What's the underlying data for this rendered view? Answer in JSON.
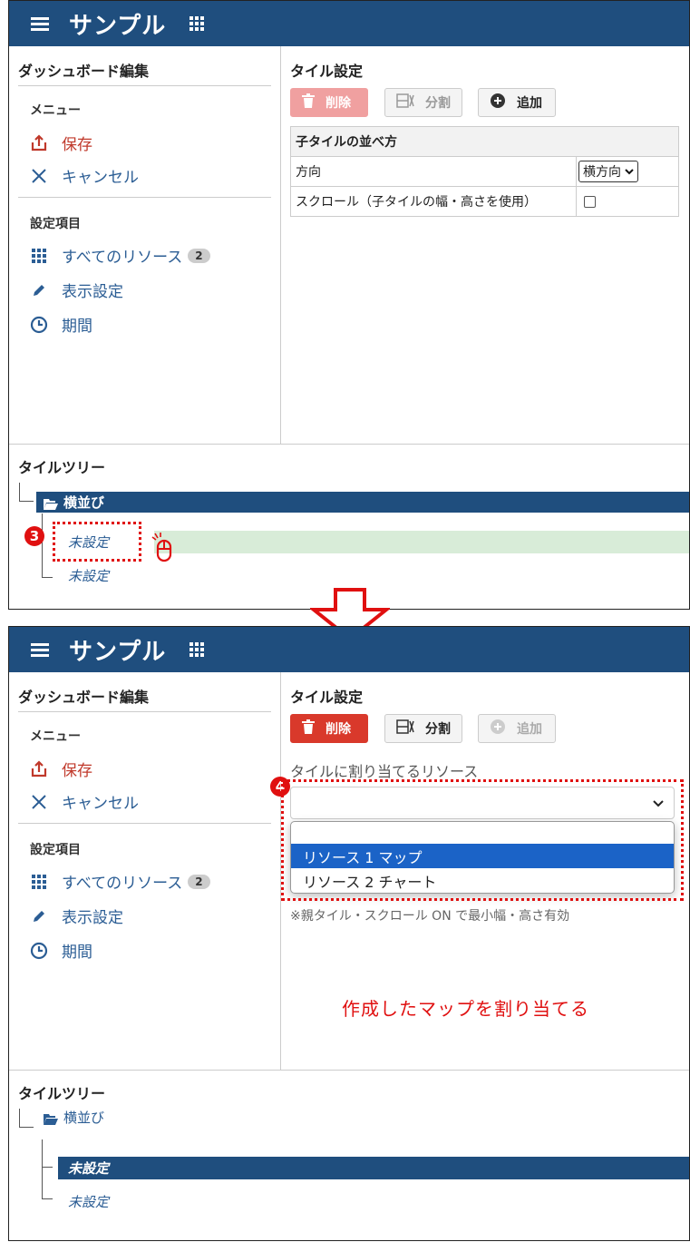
{
  "header": {
    "title": "サンプル"
  },
  "left": {
    "title": "ダッシュボード編集",
    "menu_group": "メニュー",
    "save": "保存",
    "cancel": "キャンセル",
    "settings_group": "設定項目",
    "all_resources": "すべてのリソース",
    "all_resources_count": "2",
    "display_settings": "表示設定",
    "period": "期間"
  },
  "right": {
    "title": "タイル設定",
    "delete": "削除",
    "split": "分割",
    "add": "追加",
    "table": {
      "header": "子タイルの並べ方",
      "direction_label": "方向",
      "direction_value": "横方向",
      "scroll_label": "スクロール（子タイルの幅・高さを使用）"
    },
    "resource_label": "タイルに割り当てるリソース",
    "options": [
      "リソース 1 マップ",
      "リソース 2 チャート"
    ],
    "note": "※親タイル・スクロール ON で最小幅・高さ有効"
  },
  "tree": {
    "title": "タイルツリー",
    "root": "横並び",
    "children": [
      "未設定",
      "未設定"
    ]
  },
  "annotations": {
    "step3": "3",
    "step4": "4",
    "callout": "作成したマップを割り当てる"
  },
  "colors": {
    "header": "#1f4e7e",
    "accent_red": "#e01010",
    "delete_disabled": "#f0a0a0",
    "delete_active": "#d9392b",
    "link_blue": "#2b5d94",
    "hover_green": "#d8ecd8",
    "option_selected": "#1b63c7"
  }
}
